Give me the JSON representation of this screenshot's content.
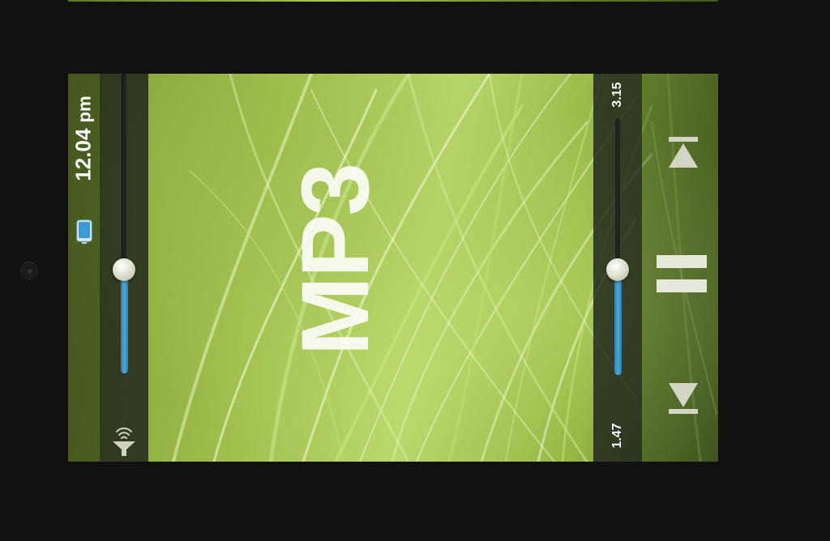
{
  "status": {
    "time": "12.04",
    "ampm": "pm"
  },
  "player": {
    "title": "MP3",
    "total_time": "3.15",
    "elapsed_time": "1.47",
    "volume_level": 0.52,
    "progress_level": 0.47
  },
  "controls": {
    "next_icon": "skip-next-icon",
    "pause_icon": "pause-icon",
    "prev_icon": "skip-previous-icon"
  },
  "icons": {
    "phone": "phone-icon",
    "wifi": "wifi-icon",
    "camera": "camera-icon"
  },
  "colors": {
    "accent": "#4ca6dc",
    "background": "#111111",
    "panel": "#1e2420"
  }
}
